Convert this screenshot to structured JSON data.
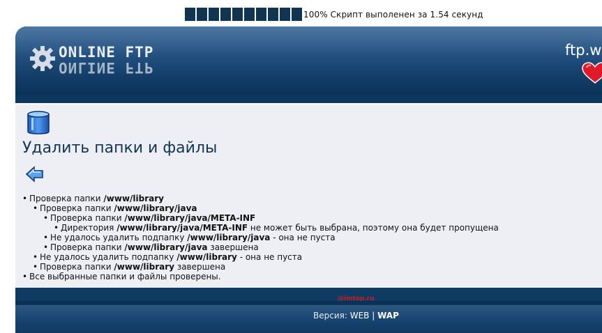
{
  "progress": {
    "filled_cells": 10,
    "text": "100% Скрипт выполенен за 1.54 секунд"
  },
  "header": {
    "logo_text": "ONLINE FTP",
    "site_name": "ftp.w"
  },
  "page": {
    "title": "Удалить папки и файлы"
  },
  "log": [
    {
      "level": 0,
      "prefix": "Проверка папки ",
      "path": "/www/library",
      "suffix": ""
    },
    {
      "level": 1,
      "prefix": "Проверка папки ",
      "path": "/www/library/java",
      "suffix": ""
    },
    {
      "level": 2,
      "prefix": "Проверка папки ",
      "path": "/www/library/java/META-INF",
      "suffix": ""
    },
    {
      "level": 3,
      "prefix": "Директория ",
      "path": "/www/library/java/META-INF",
      "suffix": " не может быть выбрана, поэтому она будет пропущена"
    },
    {
      "level": 2,
      "prefix": "Не удалось удалить подпапку ",
      "path": "/www/library/java",
      "suffix": " - она не пуста"
    },
    {
      "level": 2,
      "prefix": "Проверка папки ",
      "path": "/www/library/java",
      "suffix": " завершена"
    },
    {
      "level": 1,
      "prefix": "Не удалось удалить подпапку ",
      "path": "/www/library",
      "suffix": " - она не пуста"
    },
    {
      "level": 1,
      "prefix": "Проверка папки ",
      "path": "/www/library",
      "suffix": " завершена"
    },
    {
      "level": 0,
      "prefix": "Все выбранные папки и файлы проверены.",
      "path": "",
      "suffix": ""
    }
  ],
  "footer": {
    "counter": "@imtop.ru",
    "version_label": "Версия: ",
    "web_label": "WEB",
    "separator": " | ",
    "wap_label": "WAP"
  },
  "icons": {
    "logo": "gear-icon",
    "favorite": "heart-icon",
    "database": "database-icon",
    "back": "back-arrow-icon"
  },
  "colors": {
    "frame": "#0f3b63",
    "content_bg": "#eeeff4",
    "title": "#11365a",
    "progress": "#0f3553",
    "heart": "#e01a2a"
  }
}
